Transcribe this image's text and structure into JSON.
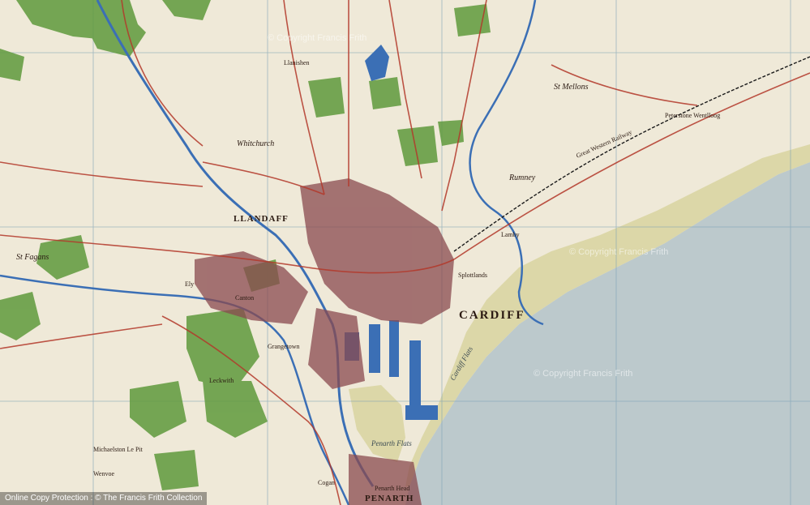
{
  "colors": {
    "land": "#efe9d8",
    "sea": "#bcc9cc",
    "sand": "#dcd7a8",
    "woodland": "#5f9a3c",
    "urban": "#8a4a4f",
    "roads": "#b3382a",
    "water": "#3b6fb5",
    "grid": "#7aa0b5"
  },
  "labels": {
    "cardiff": "CARDIFF",
    "llandaff": "LLANDAFF",
    "penarth": "PENARTH",
    "whitchurch": "Whitchurch",
    "st_mellons": "St Mellons",
    "rumney": "Rumney",
    "splottlands": "Splottlands",
    "lamby": "Lamby",
    "canton": "Canton",
    "ely": "Ely",
    "st_fagans": "St Fagans",
    "leckwith": "Leckwith",
    "grangetown": "Grangetown",
    "cardiff_flats": "Cardiff Flats",
    "penarth_flats": "Penarth Flats",
    "penarth_head": "Penarth Head",
    "cogan": "Cogan",
    "llanishen": "Llanishen",
    "peterstone_wentlloog": "Peterstone Wentlloog",
    "great_western_railway": "Great Western Railway",
    "michaelston": "Michaelston Le Pit",
    "wenvoe": "Wenvoe"
  },
  "watermarks": {
    "copyright_center": "© Copyright Francis Frith",
    "copyright_coast": "© Copyright Francis Frith",
    "copyright_top": "© Copyright Francis Frith",
    "bottom_left": "Online Copy Protection : © The Francis Frith Collection"
  }
}
